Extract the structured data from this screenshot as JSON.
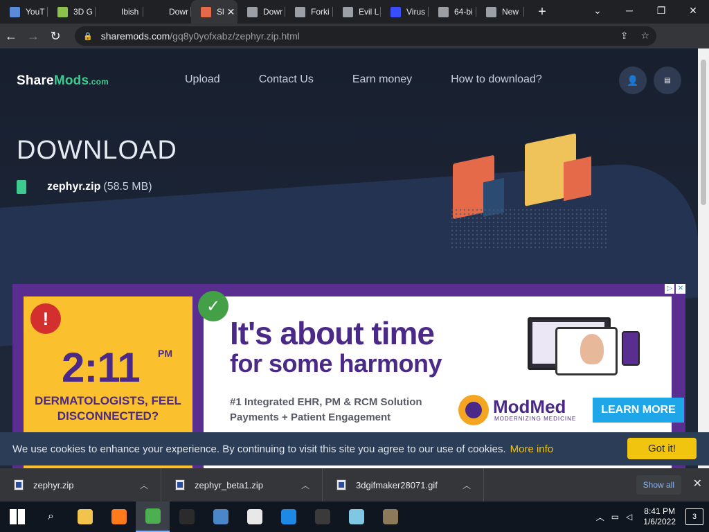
{
  "browser": {
    "tabs": [
      {
        "title": "YouT",
        "icon": "download-icon",
        "color": "#5b8bd6"
      },
      {
        "title": "3D G",
        "icon": "gem-icon",
        "color": "#8bc34a"
      },
      {
        "title": "Ibish",
        "icon": "blank-icon",
        "color": "#202124"
      },
      {
        "title": "Dowr",
        "icon": "blank-icon",
        "color": "#202124"
      },
      {
        "title": "Sl",
        "icon": "sharemods-icon",
        "color": "#e46a4a",
        "active": true
      },
      {
        "title": "Dowr",
        "icon": "globe-icon",
        "color": "#9aa0a6"
      },
      {
        "title": "Forki",
        "icon": "fork-icon",
        "color": "#9aa0a6"
      },
      {
        "title": "Evil L",
        "icon": "image-icon",
        "color": "#9aa0a6"
      },
      {
        "title": "Virus",
        "icon": "virustotal-icon",
        "color": "#394eff"
      },
      {
        "title": "64-bi",
        "icon": "page-icon",
        "color": "#9aa0a6"
      },
      {
        "title": "New",
        "icon": "chrome-icon",
        "color": "#9aa0a6"
      }
    ],
    "url_host": "sharemods.com",
    "url_path": "/gq8y0yofxabz/zephyr.zip.html"
  },
  "site": {
    "logo": {
      "share": "Share",
      "mods": "Mods",
      "com": ".com"
    },
    "nav": [
      "Upload",
      "Contact Us",
      "Earn money",
      "How to download?"
    ],
    "heading": "DOWNLOAD",
    "file_name": "zephyr.zip",
    "file_size": "(58.5 MB)"
  },
  "ad": {
    "time": "2:11",
    "pm": "PM",
    "dermatologists": "DERMATOLOGISTS, FEEL DISCONNECTED?",
    "headline1": "It's about time",
    "headline2": "for some harmony",
    "sub1": "#1 Integrated EHR, PM & RCM Solution",
    "sub2": "Payments + Patient Engagement",
    "brand": "ModMed",
    "brand_sub": "MODERNIZING MEDICINE",
    "cta": "LEARN MORE"
  },
  "cookie": {
    "text": "We use cookies to enhance your experience. By continuing to visit this site you agree to our use of cookies.",
    "more": "More info",
    "button": "Got it!"
  },
  "downloads": {
    "items": [
      "zephyr.zip",
      "zephyr_beta1.zip",
      "3dgifmaker28071.gif"
    ],
    "show_all": "Show all"
  },
  "taskbar": {
    "time": "8:41 PM",
    "date": "1/6/2022",
    "notifications": "3",
    "apps": [
      {
        "icon": "file-explorer-icon",
        "color": "#f3c44b"
      },
      {
        "icon": "firefox-icon",
        "color": "#ff7a1a"
      },
      {
        "icon": "chrome-icon",
        "color": "#4caf50",
        "active": true
      },
      {
        "icon": "obs-icon",
        "color": "#2b2b2b"
      },
      {
        "icon": "qbittorrent-icon",
        "color": "#4a86c8"
      },
      {
        "icon": "photos-icon",
        "color": "#e8e8e8"
      },
      {
        "icon": "movies-icon",
        "color": "#1e88e5"
      },
      {
        "icon": "terminal-icon",
        "color": "#3a3a3a"
      },
      {
        "icon": "3d-viewer-icon",
        "color": "#7fc7e3"
      },
      {
        "icon": "gimp-icon",
        "color": "#8d7a5a"
      }
    ]
  }
}
